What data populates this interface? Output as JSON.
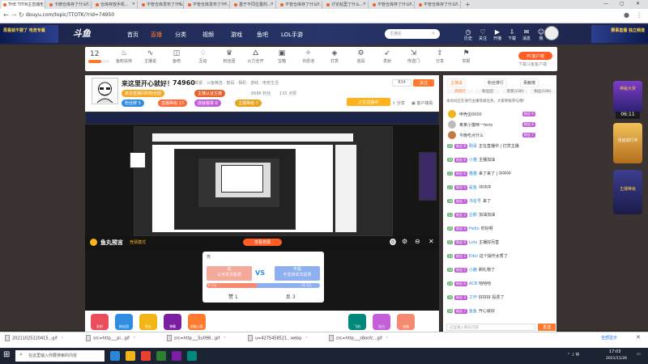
{
  "tabs": [
    "THE TITIN主直播主题...",
    "卡牌仓库存了什么...",
    "仓库存放手机...",
    "不管仓库发布了什么...",
    "不管仓库发布了什...",
    "基于不同位置的...",
    "不管仓库存了什么...",
    "讨论帖里了什么...",
    "不管仓库存了什么...",
    "不管仓库存了什么..."
  ],
  "address": "douyu.com/topic/TTOTK/?rid=74950",
  "header": {
    "nav": [
      "首页",
      "直播",
      "分类",
      "视频",
      "游戏",
      "鱼吧",
      "LOL手游"
    ],
    "search_placeholder": "主播名",
    "icons": [
      "历史",
      "关注",
      "开播",
      "下载",
      "消息",
      "我"
    ],
    "ad_left": "再看就不要了 电竞专属",
    "ad_right": "赛事直播 独立频道"
  },
  "topstrip": {
    "level": "12",
    "items": [
      "鱼粉扶持",
      "主播说",
      "鱼吧",
      "互动",
      "粉丝团",
      "火力全开",
      "宝箱",
      "许愿池",
      "打赏",
      "道具",
      "发射",
      "传送门",
      "分享",
      "举报"
    ],
    "count_label": "12",
    "pc_button": "PC客户端",
    "pc_sub": "下载斗鱼客户端"
  },
  "streamer": {
    "title": "来这里开心就好！",
    "room_id": "74960",
    "meta": "举报 · 斗鱼精选 · 数码 · 相机 · 游戏 · 电竞生活",
    "tag1": "来自直播间的粉丝团",
    "tag2": "主播认证主播",
    "count1": "6686",
    "count2": "135",
    "count1_suffix": "粉丝",
    "count2_suffix": "点赞",
    "follow": "关注",
    "follow_count": "834",
    "badge_a": "粉丝牌 5",
    "badge_b": "直播等级 13",
    "badge_c": "成就徽章 6",
    "badge_d": "主播等级 7",
    "share": "分享",
    "client": "客户端看",
    "live_label": "正在直播中"
  },
  "fishbar": {
    "title": "鱼丸预言",
    "sub": "竞猜模式",
    "center": "查看竞猜"
  },
  "vote": {
    "header": "竞",
    "left_title": "是",
    "left_sub": "认可本次投票",
    "right_title": "不是",
    "right_sub": "不支持本次投票",
    "left_num": "9.1万",
    "right_num": "11.5万",
    "left_btn": "赞 1",
    "right_btn": "反 3",
    "vs": "VS",
    "left_ratio": 0.44
  },
  "chat": {
    "tabs": [
      "主播说",
      "粉丝排行",
      "贡献榜"
    ],
    "subtabs": [
      "周排行",
      "粉丝团",
      "贵宾(236)",
      "粉丝(196)"
    ],
    "notice": "本房间正在进行主播等级任务，大家积极参与哦！",
    "top_users": [
      {
        "name": "甲壳虫0000",
        "badge": "粉丝 9"
      },
      {
        "name": "某某小猫咪一ferio",
        "badge": "粉丝 8"
      },
      {
        "name": "今晚吃点什么",
        "badge": "粉丝 7"
      }
    ],
    "lines": [
      {
        "lv": "20",
        "badge": "粉丝 8",
        "nick": "刚哥",
        "text": "正在直播中 | 打赏主播"
      },
      {
        "lv": "30",
        "badge": "粉丝 9",
        "nick": "小猫",
        "text": "主播加油"
      },
      {
        "lv": "15",
        "badge": "粉丝 6",
        "nick": "猫猫",
        "text": "来了来了 | 冲冲冲"
      },
      {
        "lv": "22",
        "badge": "粉丝 5",
        "nick": "鲨鱼",
        "text": "冲冲冲"
      },
      {
        "lv": "18",
        "badge": "粉丝 7",
        "nick": "书名号",
        "text": "来了"
      },
      {
        "lv": "12",
        "badge": "粉丝 3",
        "nick": "企鹅",
        "text": "加油加油"
      },
      {
        "lv": "26",
        "badge": "粉丝 4",
        "nick": "Hello",
        "text": "你好呀"
      },
      {
        "lv": "31",
        "badge": "粉丝 9",
        "nick": "Lolo",
        "text": "主播好厉害"
      },
      {
        "lv": "10",
        "badge": "粉丝 2",
        "nick": "Edol",
        "text": "这个操作太秀了"
      },
      {
        "lv": "19",
        "badge": "粉丝 5",
        "nick": "小鹿",
        "text": "刷礼物了"
      },
      {
        "lv": "24",
        "badge": "粉丝 6",
        "nick": "ACB",
        "text": "哈哈哈"
      },
      {
        "lv": "16",
        "badge": "粉丝 3",
        "nick": "工作",
        "text": "好好好 投票了"
      },
      {
        "lv": "28",
        "badge": "粉丝 7",
        "nick": "鱼鱼",
        "text": "开心就好"
      }
    ],
    "input_placeholder": "这里输入聊天内容",
    "send": "发送"
  },
  "right_decor": {
    "top": "神秘大奖",
    "time": "06:11",
    "mid": "活动进行中",
    "lower": "主播等级"
  },
  "gifts": [
    "发射",
    "粉丝团",
    "鱼丸",
    "弹幕",
    "超级火箭",
    "飞机",
    "告白",
    "宝箱"
  ],
  "downloads": [
    "20211025220415...gif",
    "src=http___pi...gif",
    "src=http___5u098...gif",
    "u=4275458521...webp",
    "src=http___s8onfc...gif"
  ],
  "download_all": "全部显示",
  "taskbar": {
    "search": "在这里输入你要搜索的内容",
    "time": "17:03",
    "date": "2021/11/26"
  }
}
